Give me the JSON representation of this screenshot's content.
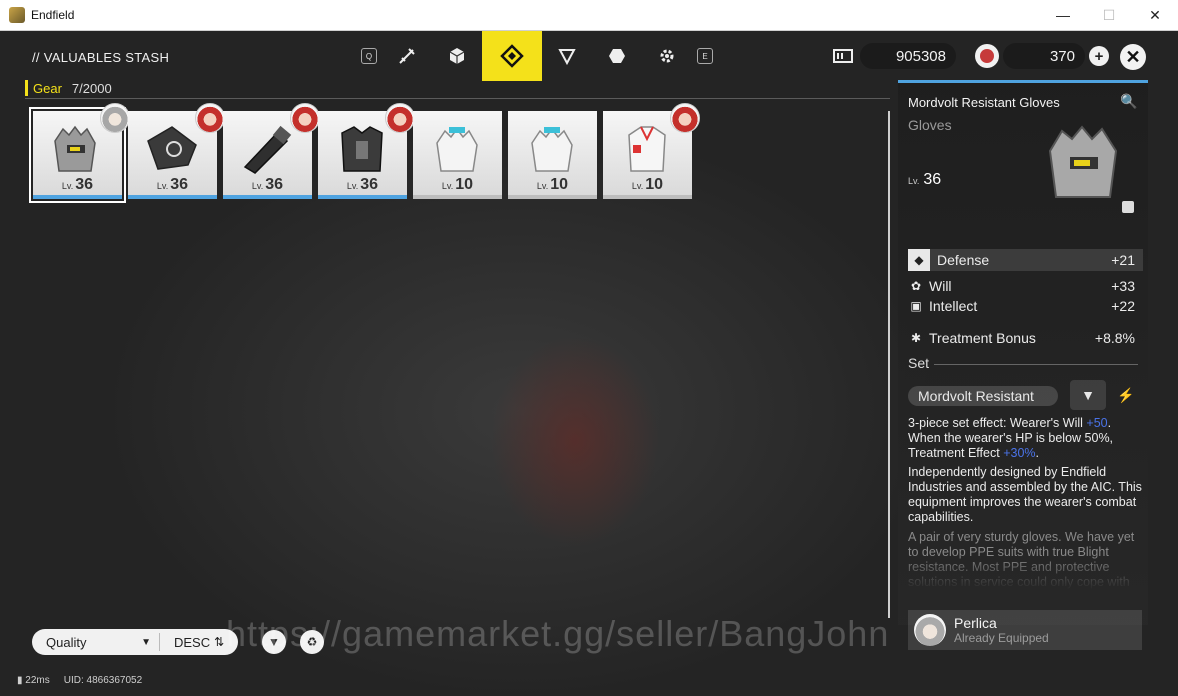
{
  "window": {
    "title": "Endfield",
    "minimize": "—",
    "maximize": "☐",
    "close": "✕"
  },
  "header": {
    "stash_title": "// VALUABLES STASH",
    "tab_keys": {
      "left": "Q",
      "right": "E"
    },
    "currency_a": "905308",
    "currency_b": "370",
    "add_symbol": "+",
    "close_symbol": "✕"
  },
  "gear_bar": {
    "label": "Gear",
    "count": "7/2000"
  },
  "items": [
    {
      "lv_prefix": "Lv.",
      "level": "36",
      "type": "gloves-equipped"
    },
    {
      "lv_prefix": "Lv.",
      "level": "36",
      "type": "kit"
    },
    {
      "lv_prefix": "Lv.",
      "level": "36",
      "type": "flashlight"
    },
    {
      "lv_prefix": "Lv.",
      "level": "36",
      "type": "armor"
    },
    {
      "lv_prefix": "Lv.",
      "level": "10",
      "type": "gloves-white"
    },
    {
      "lv_prefix": "Lv.",
      "level": "10",
      "type": "gloves-white"
    },
    {
      "lv_prefix": "Lv.",
      "level": "10",
      "type": "jacket"
    }
  ],
  "detail": {
    "name": "Mordvolt Resistant Gloves",
    "type": "Gloves",
    "lv_prefix": "Lv.",
    "level": "36",
    "stats": [
      {
        "name": "Defense",
        "value": "+21",
        "icon": "shield-icon"
      },
      {
        "name": "Will",
        "value": "+33",
        "icon": "will-icon"
      },
      {
        "name": "Intellect",
        "value": "+22",
        "icon": "intellect-icon"
      },
      {
        "name": "Treatment Bonus",
        "value": "+8.8%",
        "icon": "treatment-icon"
      }
    ],
    "set_label": "Set",
    "set_name": "Mordvolt Resistant",
    "set_effect_1": "3-piece set effect: Wearer's Will ",
    "set_effect_hl1": "+50",
    "set_effect_2": ". When the wearer's HP is below 50%, Treatment Effect ",
    "set_effect_hl2": "+30%",
    "set_effect_3": ".",
    "description": "Independently designed by Endfield Industries and assembled by the AIC. This equipment improves the wearer's combat capabilities.",
    "flavor": "A pair of very sturdy gloves. We have yet to develop PPE suits with true Blight resistance. Most PPE and protective solutions in service could only cope with secondary disasters of",
    "equipped_name": "Perlica",
    "equipped_status": "Already Equipped"
  },
  "toolbar": {
    "sort_field": "Quality",
    "sort_order": "DESC"
  },
  "watermark": "https://gamemarket.gg/seller/BangJohn",
  "footer": {
    "ping": "22ms",
    "uid": "UID: 4866367052"
  },
  "colors": {
    "accent_yellow": "#f4e11a",
    "accent_blue": "#4fa3e0",
    "highlight_blue": "#4a73e8"
  }
}
